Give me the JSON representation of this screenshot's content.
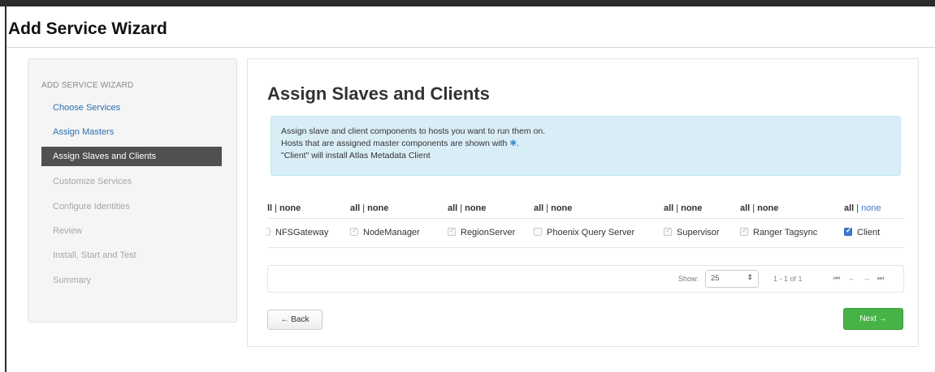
{
  "window": {
    "title": "Add Service Wizard"
  },
  "sidebar": {
    "header": "ADD SERVICE WIZARD",
    "items": [
      {
        "label": "Choose Services",
        "state": "done"
      },
      {
        "label": "Assign Masters",
        "state": "done"
      },
      {
        "label": "Assign Slaves and Clients",
        "state": "active"
      },
      {
        "label": "Customize Services",
        "state": "todo"
      },
      {
        "label": "Configure Identities",
        "state": "todo"
      },
      {
        "label": "Review",
        "state": "todo"
      },
      {
        "label": "Install, Start and Test",
        "state": "todo"
      },
      {
        "label": "Summary",
        "state": "todo"
      }
    ]
  },
  "main": {
    "title": "Assign Slaves and Clients",
    "info": {
      "line1": "Assign slave and client components to hosts you want to run them on.",
      "line2_prefix": "Hosts that are assigned master components are shown with",
      "line2_marker": "✱",
      "line2_suffix": ".",
      "line3": "\"Client\" will install Atlas Metadata Client"
    },
    "table": {
      "select_all": "all",
      "select_none": "none",
      "select_all_partial": "ll",
      "columns": [
        {
          "component": "NFSGateway",
          "checked": true,
          "partial": true
        },
        {
          "component": "NodeManager",
          "checked": true
        },
        {
          "component": "RegionServer",
          "checked": true
        },
        {
          "component": "Phoenix Query Server",
          "checked": false
        },
        {
          "component": "Supervisor",
          "checked": true
        },
        {
          "component": "Ranger Tagsync",
          "checked": true
        },
        {
          "component": "Client",
          "checked": true,
          "active": true
        }
      ]
    },
    "pager": {
      "show_label": "Show:",
      "page_size": "25",
      "range": "1 - 1 of 1",
      "first": "⏮",
      "prev": "←",
      "next": "→",
      "last": "⏭"
    },
    "buttons": {
      "back": "← Back",
      "next": "Next →"
    }
  },
  "colors": {
    "accent_blue": "#2a6fb0",
    "success_green": "#47b347",
    "info_bg": "#d9edf7",
    "active_nav": "#505050"
  }
}
